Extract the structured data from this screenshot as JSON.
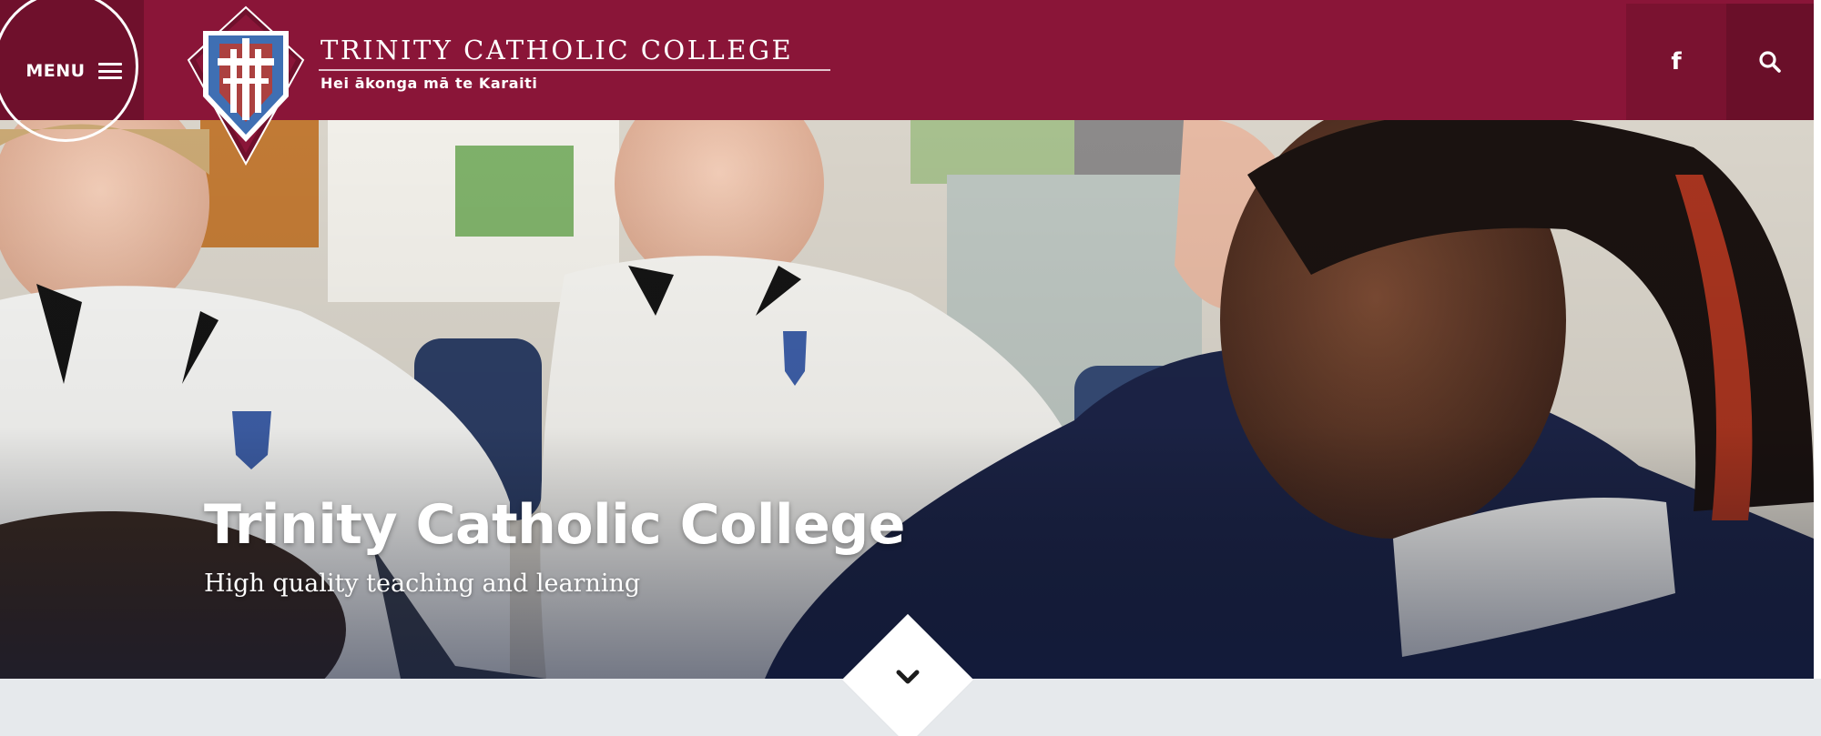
{
  "header": {
    "menu_label": "MENU",
    "brand_title": "TRINITY CATHOLIC COLLEGE",
    "brand_motto": "Hei ākonga mā te Karaiti",
    "facebook_glyph": "f",
    "icons": {
      "menu": "hamburger-icon",
      "facebook": "facebook-icon",
      "search": "search-icon",
      "crest": "college-crest"
    }
  },
  "hero": {
    "title": "Trinity Catholic College",
    "subtitle": "High quality teaching and learning"
  },
  "scroll": {
    "icon": "chevron-down-icon"
  },
  "colors": {
    "brand": "#8a1538",
    "brand_dark": "#6f102c",
    "search_bg": "#6a0f29",
    "band": "#e6e9ec",
    "crest_blue": "#3f6fb3",
    "navy_uniform": "#1c2447"
  }
}
